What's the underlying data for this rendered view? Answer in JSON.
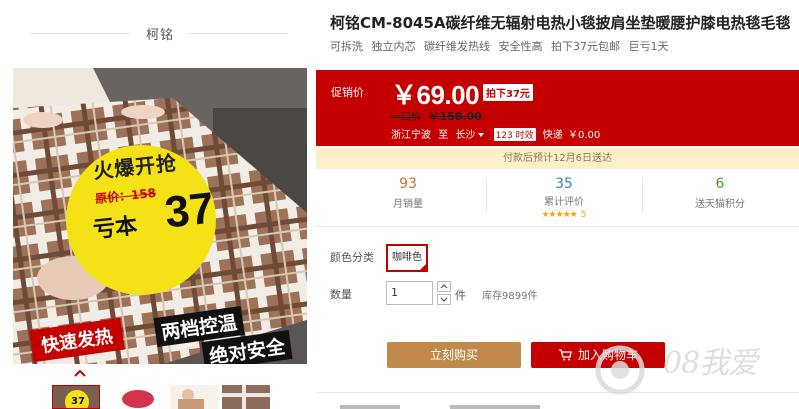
{
  "shop": {
    "name": "柯铭"
  },
  "product": {
    "title": "柯铭CM-8045A碳纤维无辐射电热小毯披肩坐垫暖腰护膝电热毯毛毯",
    "tags": [
      "可拆洗",
      "独立内芯",
      "碳纤维发热线",
      "安全性高",
      "拍下37元包邮",
      "巨亏1天"
    ]
  },
  "hero_image": {
    "line1": "火爆开抢",
    "orig_label": "原价：158",
    "line2": "亏本",
    "line2_num": "37",
    "bottom_left": "快速发热",
    "bottom_right_1": "两档控温",
    "bottom_right_2": "绝对安全"
  },
  "thumbnails": {
    "first_label": "37",
    "items": [
      "thumb-1",
      "thumb-2",
      "thumb-3",
      "thumb-4"
    ]
  },
  "price": {
    "label": "促销价",
    "current": "￥69.00",
    "discount_badge": "拍下37元",
    "orig_label": "一口价",
    "orig_price": "￥158.00"
  },
  "shipping": {
    "from": "浙江宁波",
    "to_label": "至",
    "to": "长沙",
    "hours_badge": "123 时效",
    "method": "快递",
    "fee": "￥0.00"
  },
  "delivery_note": "付款后预计12月6日送达",
  "stats": {
    "sales": {
      "value": "93",
      "label": "月销量",
      "color": "#c9751b"
    },
    "reviews": {
      "value": "35",
      "label": "累计评价",
      "color": "#3c7fc0",
      "stars": "★★★★★",
      "star_count": "5"
    },
    "points": {
      "value": "6",
      "label": "送天猫积分",
      "color": "#4f9a2c"
    }
  },
  "options": {
    "color_label": "颜色分类",
    "color_value": "咖啡色",
    "qty_label": "数量",
    "qty_value": "1",
    "qty_unit": "件",
    "stock": "库存9899件"
  },
  "actions": {
    "buy_now": "立刻购买",
    "add_to_cart": "加入购物车"
  },
  "watermark": {
    "text": "08我爱"
  },
  "colors": {
    "brand_red": "#c40000",
    "buy_button": "#c18a4d",
    "delivery_bg": "#fdf0c7"
  }
}
